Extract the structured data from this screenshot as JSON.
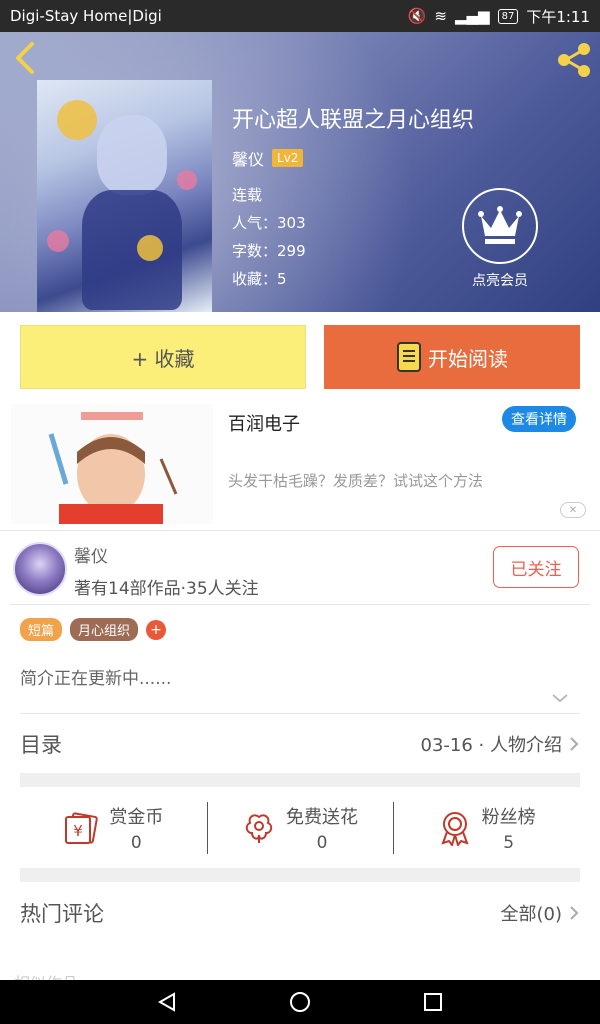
{
  "status_bar": {
    "left_text": "Digi-Stay Home|Digi",
    "battery": "87",
    "time": "下午1:11"
  },
  "book": {
    "title": "开心超人联盟之月心组织",
    "author": "馨仪",
    "level": "Lv2",
    "status": "连载",
    "popularity": "人气：303",
    "word_count": "字数：299",
    "favorites": "收藏：5"
  },
  "vip": {
    "label": "点亮会员"
  },
  "actions": {
    "favorite": "+ 收藏",
    "read": "开始阅读"
  },
  "ad": {
    "title": "百润电子",
    "button": "查看详情",
    "description": "头发干枯毛躁？发质差？试试这个方法",
    "close": "✕"
  },
  "author_section": {
    "name": "馨仪",
    "stats": "著有14部作品·35人关注",
    "follow_button": "已关注"
  },
  "tags": [
    "短篇",
    "月心组织"
  ],
  "tag_add": "+",
  "intro": "简介正在更新中......",
  "directory": {
    "title": "目录",
    "latest": "03-16 · 人物介绍"
  },
  "rewards": [
    {
      "label": "赏金币",
      "value": "0",
      "icon": "coin-reward-icon"
    },
    {
      "label": "免费送花",
      "value": "0",
      "icon": "flower-icon"
    },
    {
      "label": "粉丝榜",
      "value": "5",
      "icon": "medal-icon"
    }
  ],
  "comments": {
    "title": "热门评论",
    "all": "全部(0)"
  },
  "similar": "相似作品",
  "colors": {
    "accent_orange": "#e86c3d",
    "favorite_yellow": "#fbef7a",
    "follow_red": "#ef5e4f",
    "link_blue": "#1e88e5",
    "reward_icon_red": "#c0392b"
  }
}
